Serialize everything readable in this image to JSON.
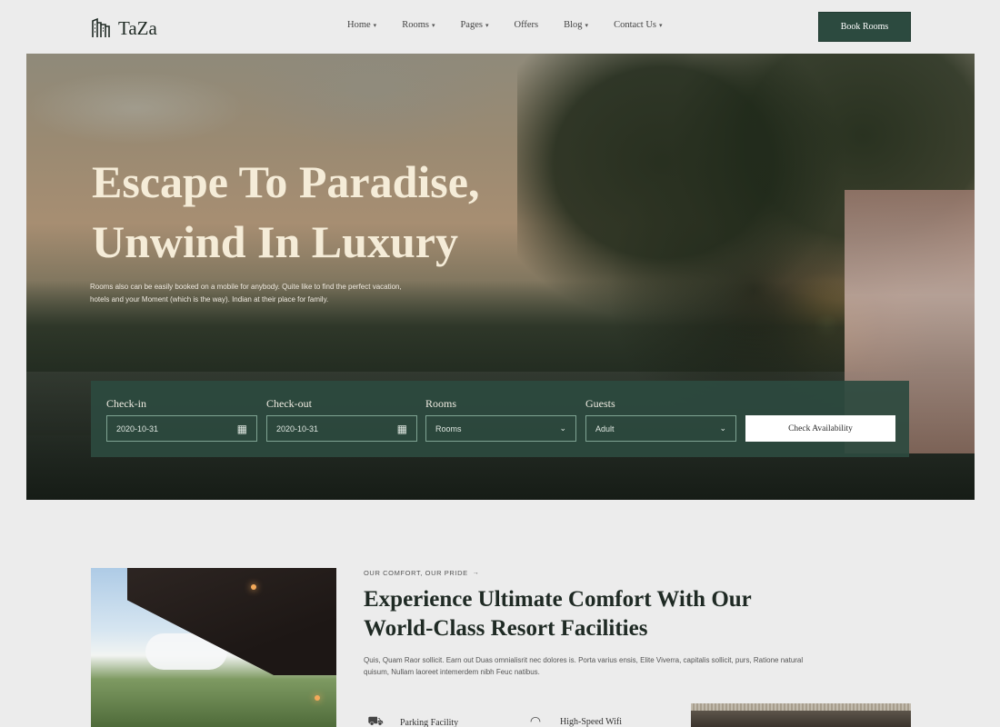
{
  "header": {
    "logo_text": "TaZa",
    "logo_icon": "building-icon",
    "nav": [
      {
        "label": "Home"
      },
      {
        "label": "Rooms"
      },
      {
        "label": "Pages"
      },
      {
        "label": "Offers"
      },
      {
        "label": "Blog"
      },
      {
        "label": "Contact Us"
      }
    ],
    "cta_label": "Book Rooms"
  },
  "hero": {
    "title_line1": "Escape To Paradise,",
    "title_line2": "Unwind In Luxury",
    "description": "Rooms also can be easily booked on a mobile for anybody. Quite like to find the perfect vacation, hotels and your Moment (which is the way). Indian at their place for family."
  },
  "booking": {
    "checkin": {
      "label": "Check-in",
      "value": "2020-10-31",
      "icon": "calendar-icon"
    },
    "checkout": {
      "label": "Check-out",
      "value": "2020-10-31",
      "icon": "calendar-icon"
    },
    "rooms": {
      "label": "Rooms",
      "value": "Rooms",
      "icon": "chevron-down-icon"
    },
    "guests": {
      "label": "Guests",
      "value": "Adult",
      "icon": "chevron-down-icon"
    },
    "button_label": "Check Availability"
  },
  "facilities": {
    "eyebrow": "OUR COMFORT, OUR PRIDE",
    "title_line1": "Experience Ultimate Comfort With Our",
    "title_line2": "World-Class Resort Facilities",
    "description": "Quis, Quam Raor sollicit. Earn out Duas omnialisrit nec dolores is. Porta varius ensis, Elite Viverra, capitalis sollicit, purs, Ratione natural quisum, Nullam laoreet intemerdem nibh Feuc natibus.",
    "features": [
      {
        "label": "Parking Facility",
        "icon": "car-icon"
      },
      {
        "label": "High-Speed Wifi",
        "icon": "wifi-icon"
      }
    ]
  },
  "colors": {
    "accent": "#2c4a3f",
    "background": "#ececec",
    "hero_text": "#f5ecd8"
  }
}
